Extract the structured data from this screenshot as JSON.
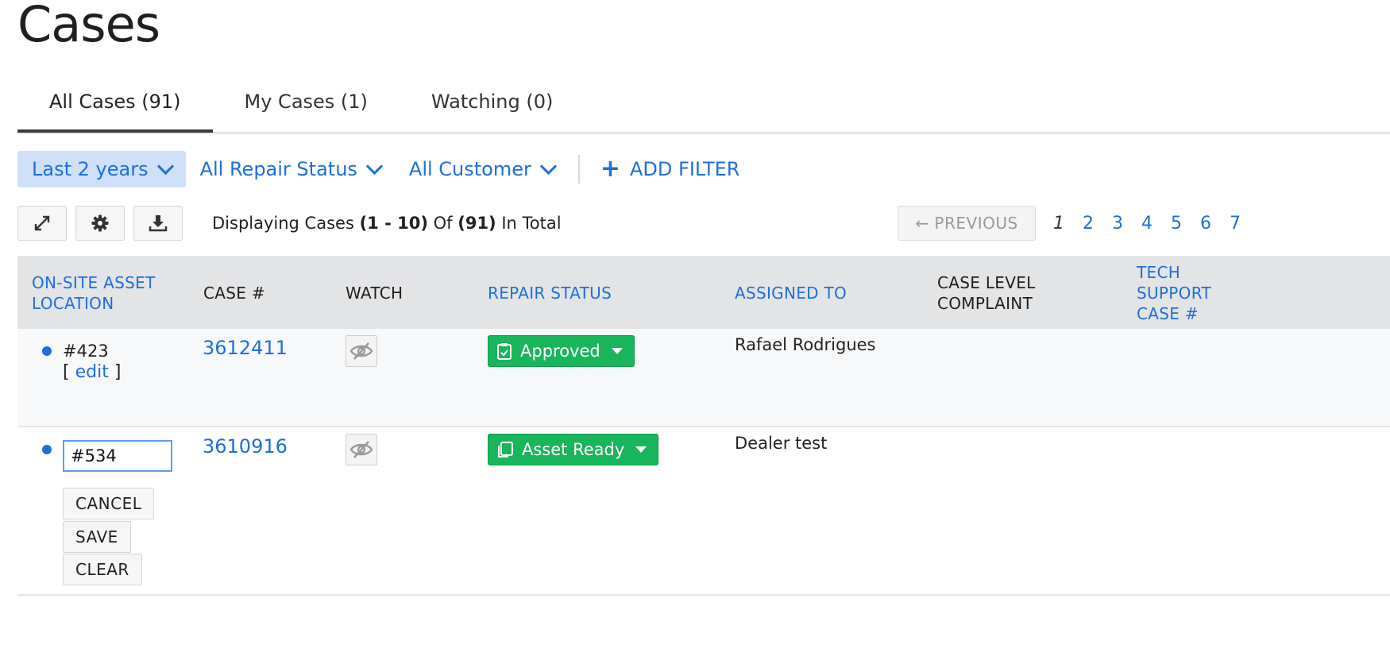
{
  "page": {
    "title": "Cases"
  },
  "tabs": [
    {
      "label": "All Cases (91)",
      "active": true
    },
    {
      "label": "My Cases (1)",
      "active": false
    },
    {
      "label": "Watching (0)",
      "active": false
    }
  ],
  "filters": {
    "date": "Last 2 years",
    "repair_status": "All Repair Status",
    "customer": "All Customer",
    "add_filter": "ADD FILTER"
  },
  "toolbar": {
    "icons": [
      "expand-icon",
      "gear-icon",
      "download-icon"
    ],
    "display_prefix": "Displaying Cases ",
    "display_range": "(1 - 10)",
    "display_of": " Of ",
    "display_total": "(91)",
    "display_suffix": " In Total"
  },
  "pagination": {
    "previous_label": "← PREVIOUS",
    "pages": [
      "1",
      "2",
      "3",
      "4",
      "5",
      "6",
      "7"
    ],
    "current": "1"
  },
  "table": {
    "headers": {
      "location": "ON-SITE ASSET LOCATION",
      "case_no": "CASE #",
      "watch": "WATCH",
      "repair_status": "REPAIR STATUS",
      "assigned_to": "ASSIGNED TO",
      "complaint": "CASE LEVEL COMPLAINT",
      "tech_support": "TECH SUPPORT CASE #"
    },
    "rows": [
      {
        "location": "#423",
        "edit_open": "[ ",
        "edit_label": "edit",
        "edit_close": " ]",
        "case_no": "3612411",
        "status": "Approved",
        "assigned_to": "Rafael Rodrigues"
      },
      {
        "location_input": "#534",
        "case_no": "3610916",
        "status": "Asset Ready",
        "assigned_to": "Dealer test",
        "buttons": {
          "cancel": "CANCEL",
          "save": "SAVE",
          "clear": "CLEAR"
        }
      }
    ]
  },
  "colors": {
    "accent": "#1e6fd9",
    "status_green": "#19b55b",
    "header_bg": "#e3e4e6"
  }
}
